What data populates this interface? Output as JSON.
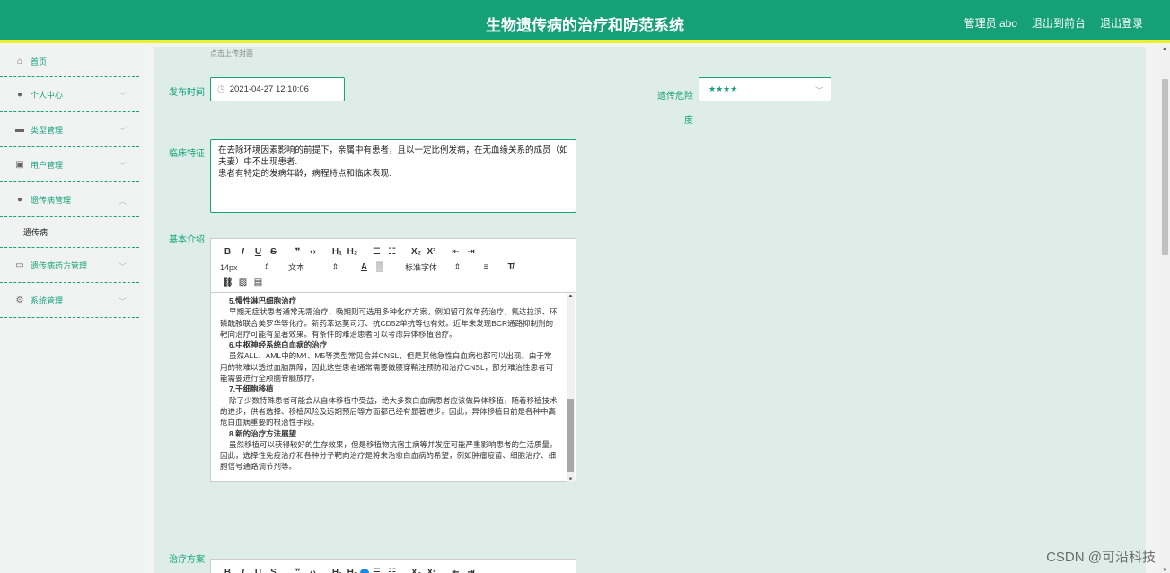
{
  "header": {
    "title": "生物遗传病的治疗和防范系统",
    "admin": "管理员 abo",
    "to_front": "退出到前台",
    "logout": "退出登录"
  },
  "sidebar": {
    "items": [
      {
        "label": "首页",
        "icon": "home-icon",
        "arrow": ""
      },
      {
        "label": "个人中心",
        "icon": "user-icon",
        "arrow": "﹀"
      },
      {
        "label": "类型管理",
        "icon": "briefcase-icon",
        "arrow": "﹀"
      },
      {
        "label": "用户管理",
        "icon": "chart-icon",
        "arrow": "﹀"
      },
      {
        "label": "遗传病管理",
        "icon": "user-icon",
        "arrow": "︿"
      },
      {
        "label": "遗传病",
        "sub": true
      },
      {
        "label": "遗传病药方管理",
        "icon": "card-icon",
        "arrow": "﹀"
      },
      {
        "label": "系统管理",
        "icon": "gear-icon",
        "arrow": "﹀"
      }
    ]
  },
  "form": {
    "upload_hint": "点击上传封面",
    "publish_time_label": "发布时间",
    "publish_time_value": "2021-04-27 12:10:06",
    "danger_label": "遗传危险度",
    "danger_value": "★★★★",
    "clinical_label": "临床特征",
    "clinical_value": "在去除环境因素影响的前提下，亲属中有患者，且以一定比例发病，在无血缘关系的成员（如夫妻）中不出现患者.\n患者有特定的发病年龄，病程特点和临床表现.",
    "intro_label": "基本介绍",
    "treatment_label": "治疗方案"
  },
  "editor": {
    "font_size": "14px",
    "block_type": "文本",
    "font_family": "标准字体",
    "content": [
      {
        "type": "h",
        "text": "5.慢性淋巴细胞治疗"
      },
      {
        "type": "t",
        "text": "早期无症状患者通常无需治疗，晚期则可选用多种化疗方案，例如留可然单药治疗，氟达拉滨、环磷酰胺联合美罗华等化疗。新药苯达莫司汀、抗CD52单抗等也有效。近年来发现BCR通路抑制剂的靶向治疗可能有显著效果。有条件的难治患者可以考虑异体移植治疗。"
      },
      {
        "type": "h",
        "text": "6.中枢神经系统白血病的治疗"
      },
      {
        "type": "t",
        "text": "虽然ALL、AML中的M4、M5等类型常见合并CNSL，但是其他急性白血病也都可以出现。由于常用的物难以透过血脑屏障，因此这些患者通常需要做腰穿鞘注预防和治疗CNSL，部分难治性患者可能需要进行全颅脑脊髓放疗。"
      },
      {
        "type": "h",
        "text": "7.干细胞移植"
      },
      {
        "type": "t",
        "text": "除了少数特殊患者可能会从自体移植中受益，绝大多数白血病患者应该做异体移植，随着移植技术的进步，供者选择、移植风险及远期预后等方面都已经有显著进步。因此，异体移植目前是各种中高危白血病重要的根治性手段。"
      },
      {
        "type": "h",
        "text": "8.新的治疗方法展望"
      },
      {
        "type": "t",
        "text": "虽然移植可以获得较好的生存效果，但是移植物抗宿主病等并发症可能严重影响患者的生活质量。因此，选择性免疫治疗和各种分子靶向治疗是将来治愈白血病的希望，例如肿瘤疫苗、细胞治疗、细胞信号通路调节剂等。"
      }
    ]
  },
  "watermark": "CSDN @可沿科技"
}
